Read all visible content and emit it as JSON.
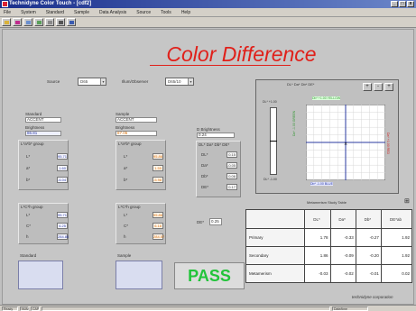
{
  "window": {
    "title": "Technidyne Color Touch - [cdf2]",
    "controls": [
      "_",
      "□",
      "x"
    ]
  },
  "menu": [
    "File",
    "System",
    "Standard",
    "Sample",
    "Data Analysis",
    "Source",
    "Tools",
    "Help"
  ],
  "headline": "Color Difference",
  "selectors": {
    "source_label": "Source",
    "source_value": "D65",
    "illuminant_label": "Illum/Observer",
    "illuminant_value": "D65/10"
  },
  "standard": {
    "label": "Standard",
    "name": "ACCENT",
    "brightness_label": "Brightness",
    "brightness": "86.81"
  },
  "sample": {
    "label": "Sample",
    "name": "ACCENT",
    "brightness_label": "Brightness",
    "brightness": "87.05"
  },
  "d_brightness": {
    "label": "D Brightness",
    "value": "0.24"
  },
  "lab": {
    "std_title": "L*a*b* group",
    "smp_title": "L*a*b* group",
    "labels": [
      "L*",
      "a*",
      "b*"
    ],
    "std": [
      "95.71",
      "1.60",
      "-6.04"
    ],
    "smp": [
      "95.86",
      "1.55",
      "-5.98"
    ]
  },
  "delta_lab": {
    "title": "DL* Da* Db* DE*",
    "labels": [
      "DL*",
      "Da*",
      "Db*",
      "DE*"
    ],
    "values": [
      "0.15",
      "-0.05",
      "0.06",
      "0.17"
    ]
  },
  "lch": {
    "std_title": "L*C*h group",
    "smp_title": "L*C*h group",
    "labels": [
      "L*",
      "C*",
      "h"
    ],
    "std": [
      "95.71",
      "6.25",
      "284.86"
    ],
    "smp": [
      "95.86",
      "6.18",
      "284.57"
    ]
  },
  "de_cmc": {
    "label": "DE*",
    "value": "0.25"
  },
  "swatches": {
    "standard_label": "Standard",
    "sample_label": "Sample"
  },
  "status": "PASS",
  "plot": {
    "title": "DL* Da* Db* DE*",
    "l_top_label": "DL* +1.00",
    "l_bottom_label": "DL* -1.00",
    "b_top_label": "Db* +1.00 YELLOW",
    "b_bottom_label": "Db* -1.00 BLUE",
    "a_left_label": "Da* -1.00 GREEN",
    "a_right_label": "Da* +1.00 RED",
    "buttons": [
      "+",
      "-",
      "+"
    ]
  },
  "metamerism": {
    "title": "Metamerism Study Table",
    "columns": [
      "DL*",
      "Da*",
      "Db*",
      "DE*ab"
    ],
    "rows": [
      {
        "label": "Primary",
        "values": [
          "1.78",
          "-0.33",
          "-0.27",
          "1.92"
        ]
      },
      {
        "label": "Secondary",
        "values": [
          "1.86",
          "-0.09",
          "-0.20",
          "1.92"
        ]
      },
      {
        "label": "Metamerism",
        "values": [
          "-0.03",
          "-0.02",
          "-0.01",
          "0.02"
        ]
      }
    ]
  },
  "brand": "technidyne corporation",
  "statusbar": [
    "Ready",
    "NUM",
    "CAP",
    "Date/time"
  ]
}
